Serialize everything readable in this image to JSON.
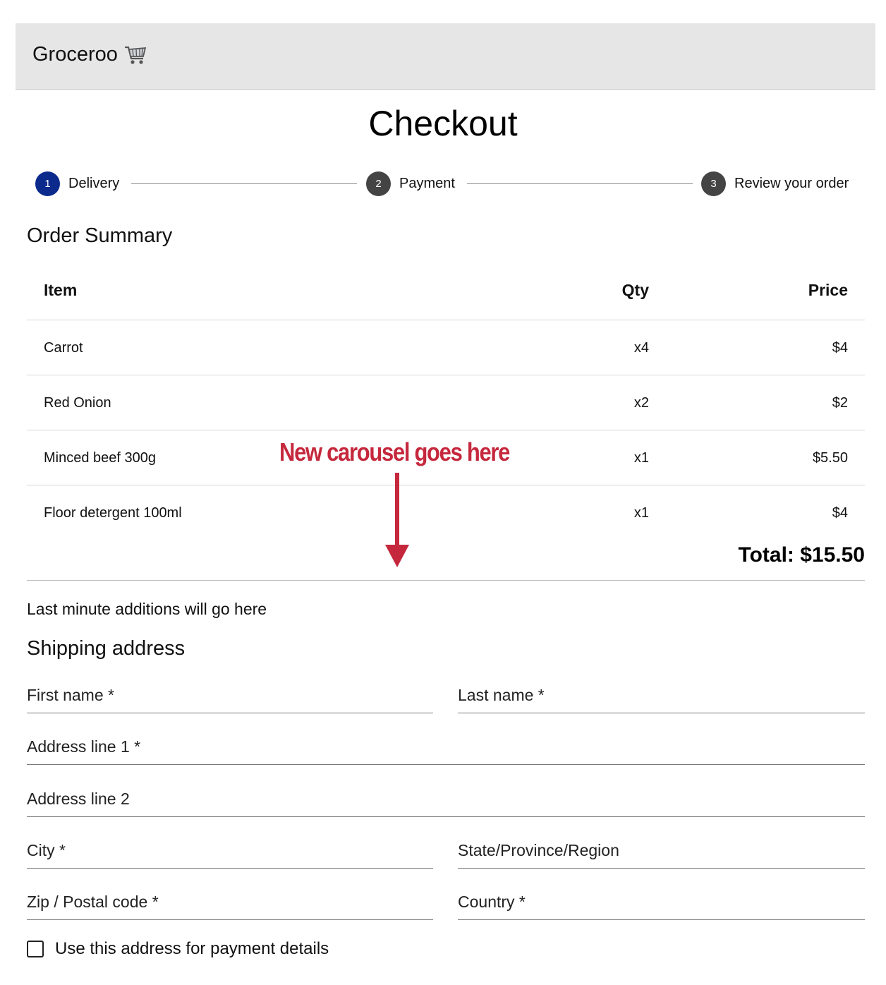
{
  "header": {
    "brand": "Groceroo",
    "brand_icon": "shopping-cart-icon"
  },
  "page": {
    "title": "Checkout"
  },
  "stepper": {
    "steps": [
      {
        "number": "1",
        "label": "Delivery",
        "active": true,
        "color": "#0b2a8c"
      },
      {
        "number": "2",
        "label": "Payment",
        "active": false,
        "color": "#444444"
      },
      {
        "number": "3",
        "label": "Review your order",
        "active": false,
        "color": "#444444"
      }
    ]
  },
  "order_summary": {
    "title": "Order Summary",
    "columns": {
      "item": "Item",
      "qty": "Qty",
      "price": "Price"
    },
    "rows": [
      {
        "item": "Carrot",
        "qty": "x4",
        "price": "$4"
      },
      {
        "item": "Red Onion",
        "qty": "x2",
        "price": "$2"
      },
      {
        "item": "Minced beef 300g",
        "qty": "x1",
        "price": "$5.50"
      },
      {
        "item": "Floor detergent 100ml",
        "qty": "x1",
        "price": "$4"
      }
    ],
    "total": "Total: $15.50"
  },
  "annotation": {
    "text": "New carousel goes here",
    "color": "#c5283d"
  },
  "last_minute": {
    "text": "Last minute additions will go here"
  },
  "shipping": {
    "title": "Shipping address",
    "first_name": "First name *",
    "last_name": "Last name *",
    "address1": "Address line 1 *",
    "address2": "Address line 2",
    "city": "City *",
    "state": "State/Province/Region",
    "zip": "Zip / Postal code *",
    "country": "Country *",
    "use_for_payment": "Use this address for payment details",
    "use_for_payment_checked": false
  }
}
